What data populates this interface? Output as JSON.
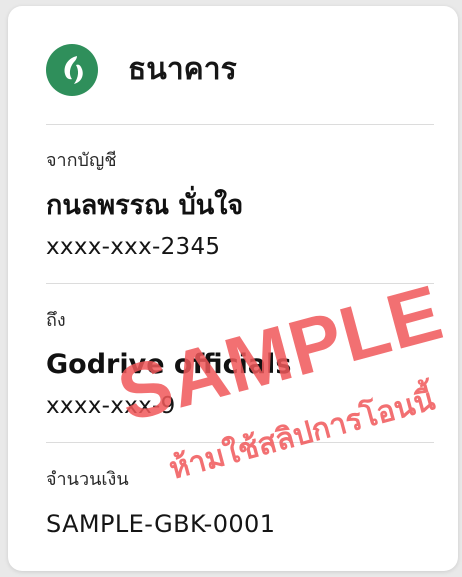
{
  "bank": {
    "logo_icon": "bank-leaf-logo",
    "name": "ธนาคาร"
  },
  "from": {
    "label": "จากบัญชี",
    "name": "กนลพรรณ บั่นใจ",
    "account": "xxxx-xxx-2345"
  },
  "to": {
    "label": "ถึง",
    "name": "Godrive officials",
    "account": "xxxx-xxx-9"
  },
  "amount": {
    "label": "จำนวนเงิน",
    "value": "SAMPLE-GBK-0001"
  },
  "watermark": {
    "main": "SAMPLE",
    "sub": "ห้ามใช้สลิปการโอนนี้",
    "color": "#f0585a"
  },
  "colors": {
    "brand": "#2f8f5b",
    "background": "#e9e9e9",
    "card": "#ffffff"
  }
}
